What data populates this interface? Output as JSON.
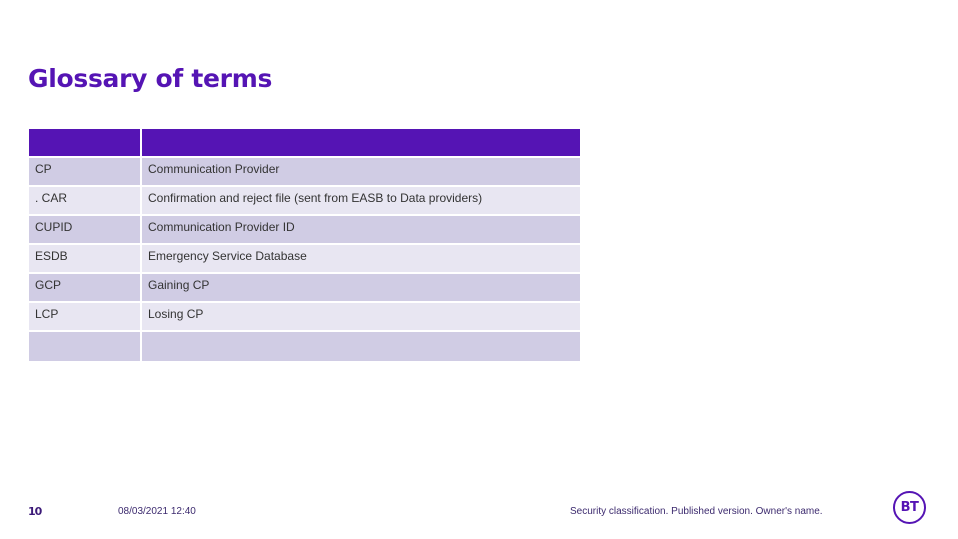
{
  "slide": {
    "title": "Glossary of terms"
  },
  "glossary": {
    "header": [
      "",
      ""
    ],
    "rows": [
      {
        "term": "CP",
        "definition": "Communication Provider"
      },
      {
        "term": ". CAR",
        "definition": "Confirmation and reject file (sent from EASB to Data providers)"
      },
      {
        "term": "CUPID",
        "definition": "Communication Provider ID"
      },
      {
        "term": "ESDB",
        "definition": "Emergency Service Database"
      },
      {
        "term": "GCP",
        "definition": "Gaining CP"
      },
      {
        "term": "LCP",
        "definition": "Losing CP"
      },
      {
        "term": "",
        "definition": ""
      }
    ]
  },
  "footer": {
    "page_number": "10",
    "date": "08/03/2021 12:40",
    "security": "Security classification. Published version. Owner's name.",
    "logo_text": "BT"
  },
  "colors": {
    "brand_purple": "#5514b4",
    "row_dark": "#d0cce4",
    "row_light": "#e8e6f2"
  }
}
